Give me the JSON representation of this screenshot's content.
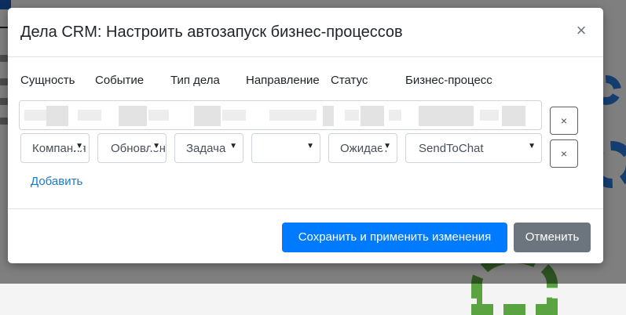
{
  "modal": {
    "title": "Дела CRM: Настроить автозапуск бизнес-процессов",
    "close_symbol": "×"
  },
  "columns": [
    "Сущность",
    "Событие",
    "Тип дела",
    "Направление",
    "Статус",
    "Бизнес-процесс"
  ],
  "rows": [
    {
      "blurred": true,
      "remove_symbol": "×"
    },
    {
      "entity": "Компания",
      "event": "Обновление",
      "activity_type": "Задача",
      "direction": "",
      "status": "Ожидает",
      "business_process": "SendToChat",
      "remove_symbol": "×"
    }
  ],
  "add_link": "Добавить",
  "buttons": {
    "save": "Сохранить и применить изменения",
    "cancel": "Отменить"
  },
  "icons": {
    "close": "close-icon",
    "remove": "remove-row-icon",
    "dropdown": "caret-down-icon"
  },
  "colors": {
    "primary": "#007bff",
    "secondary": "#6c757d",
    "link": "#1e78c8"
  }
}
